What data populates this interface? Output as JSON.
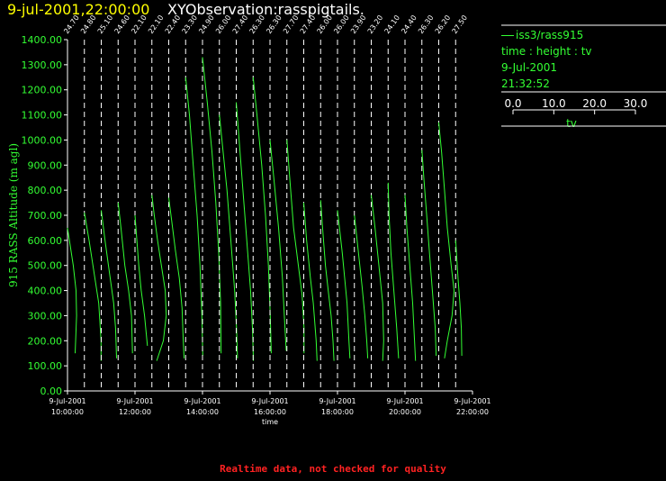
{
  "header": {
    "date_time": "9-jul-2001,22:00:00",
    "observation": "XYObservation:rasspigtails."
  },
  "legend": {
    "series_label": "iss3/rass915",
    "description": "time : height : tv",
    "date": "9-Jul-2001",
    "time": "21:32:52",
    "scale_ticks": [
      "0.0",
      "10.0",
      "20.0",
      "30.0"
    ],
    "scale_label": "tv"
  },
  "footer": {
    "note": "Realtime data, not checked for quality"
  },
  "colors": {
    "trace": "#33ff33",
    "axis": "#ffffff",
    "title_date": "#ffff00",
    "footer": "#ff2222",
    "background": "#000000"
  },
  "chart_data": {
    "type": "line",
    "title": "",
    "xlabel": "time",
    "ylabel": "915 RASS Altitude (m agl)",
    "ylim": [
      0,
      1400
    ],
    "xlim": [
      "2001-07-09 10:00",
      "2001-07-09 22:00"
    ],
    "y_ticks": [
      "0.00",
      "100.00",
      "200.00",
      "300.00",
      "400.00",
      "500.00",
      "600.00",
      "700.00",
      "800.00",
      "900.00",
      "1000.00",
      "1100.00",
      "1200.00",
      "1300.00",
      "1400.00"
    ],
    "x_ticks": [
      {
        "time": "2001-07-09 10:00",
        "date_label": "9-Jul-2001",
        "time_label": "10:00:00"
      },
      {
        "time": "2001-07-09 12:00",
        "date_label": "9-Jul-2001",
        "time_label": "12:00:00"
      },
      {
        "time": "2001-07-09 14:00",
        "date_label": "9-Jul-2001",
        "time_label": "14:00:00"
      },
      {
        "time": "2001-07-09 16:00",
        "date_label": "9-Jul-2001",
        "time_label": "16:00:00"
      },
      {
        "time": "2001-07-09 18:00",
        "date_label": "9-Jul-2001",
        "time_label": "18:00:00"
      },
      {
        "time": "2001-07-09 20:00",
        "date_label": "9-Jul-2001",
        "time_label": "20:00:00"
      },
      {
        "time": "2001-07-09 22:00",
        "date_label": "9-Jul-2001",
        "time_label": "22:00:00"
      }
    ],
    "grid": false,
    "profiles": [
      {
        "time": "2001-07-09 10:00",
        "base_label": "24.70",
        "points": [
          [
            650,
            0
          ],
          [
            500,
            1.2
          ],
          [
            400,
            1.8
          ],
          [
            300,
            1.9
          ],
          [
            150,
            1.6
          ]
        ]
      },
      {
        "time": "2001-07-09 10:30",
        "base_label": "24.80",
        "points": [
          [
            710,
            0
          ],
          [
            600,
            1.0
          ],
          [
            450,
            2.2
          ],
          [
            350,
            3.0
          ],
          [
            200,
            3.5
          ],
          [
            120,
            3.5
          ]
        ]
      },
      {
        "time": "2001-07-09 11:00",
        "base_label": "25.10",
        "points": [
          [
            720,
            0
          ],
          [
            600,
            0.8
          ],
          [
            500,
            1.5
          ],
          [
            350,
            2.6
          ],
          [
            250,
            3.0
          ],
          [
            130,
            3.2
          ]
        ]
      },
      {
        "time": "2001-07-09 11:30",
        "base_label": "24.60",
        "points": [
          [
            750,
            0
          ],
          [
            650,
            0.6
          ],
          [
            500,
            1.4
          ],
          [
            400,
            2.2
          ],
          [
            300,
            2.8
          ],
          [
            150,
            3.0
          ]
        ]
      },
      {
        "time": "2001-07-09 12:00",
        "base_label": "22.10",
        "points": [
          [
            700,
            0
          ],
          [
            600,
            0.4
          ],
          [
            500,
            0.8
          ],
          [
            400,
            1.3
          ],
          [
            300,
            2.0
          ],
          [
            180,
            2.6
          ]
        ]
      },
      {
        "time": "2001-07-09 12:30",
        "base_label": "22.10",
        "points": [
          [
            780,
            0
          ],
          [
            700,
            0.5
          ],
          [
            600,
            1.2
          ],
          [
            500,
            2.0
          ],
          [
            400,
            2.8
          ],
          [
            300,
            3.0
          ],
          [
            200,
            2.4
          ],
          [
            120,
            1.0
          ]
        ]
      },
      {
        "time": "2001-07-09 13:00",
        "base_label": "22.40",
        "points": [
          [
            770,
            0
          ],
          [
            680,
            0.6
          ],
          [
            560,
            1.4
          ],
          [
            450,
            2.2
          ],
          [
            330,
            2.8
          ],
          [
            220,
            3.0
          ],
          [
            130,
            3.2
          ]
        ]
      },
      {
        "time": "2001-07-09 13:30",
        "base_label": "23.30",
        "points": [
          [
            1250,
            0
          ],
          [
            1100,
            0.8
          ],
          [
            900,
            1.6
          ],
          [
            700,
            2.4
          ],
          [
            500,
            3.0
          ],
          [
            300,
            3.4
          ],
          [
            140,
            3.6
          ]
        ]
      },
      {
        "time": "2001-07-09 14:00",
        "base_label": "24.90",
        "points": [
          [
            1330,
            0
          ],
          [
            1150,
            1.0
          ],
          [
            950,
            2.0
          ],
          [
            750,
            2.8
          ],
          [
            550,
            3.4
          ],
          [
            350,
            3.8
          ],
          [
            150,
            3.9
          ]
        ]
      },
      {
        "time": "2001-07-09 14:30",
        "base_label": "26.00",
        "points": [
          [
            1100,
            0
          ],
          [
            950,
            0.8
          ],
          [
            800,
            1.6
          ],
          [
            600,
            2.4
          ],
          [
            400,
            3.2
          ],
          [
            250,
            3.6
          ],
          [
            130,
            3.8
          ]
        ]
      },
      {
        "time": "2001-07-09 15:00",
        "base_label": "27.40",
        "points": [
          [
            1150,
            0
          ],
          [
            1000,
            0.6
          ],
          [
            800,
            1.4
          ],
          [
            600,
            2.2
          ],
          [
            400,
            3.0
          ],
          [
            250,
            3.4
          ],
          [
            120,
            3.6
          ]
        ]
      },
      {
        "time": "2001-07-09 15:30",
        "base_label": "26.30",
        "points": [
          [
            1250,
            0
          ],
          [
            1100,
            0.8
          ],
          [
            900,
            1.8
          ],
          [
            700,
            2.6
          ],
          [
            500,
            3.2
          ],
          [
            300,
            3.6
          ],
          [
            150,
            3.8
          ]
        ]
      },
      {
        "time": "2001-07-09 16:00",
        "base_label": "26.30",
        "points": [
          [
            1000,
            0
          ],
          [
            850,
            0.8
          ],
          [
            650,
            1.8
          ],
          [
            450,
            2.6
          ],
          [
            300,
            3.0
          ],
          [
            160,
            3.4
          ]
        ]
      },
      {
        "time": "2001-07-09 16:30",
        "base_label": "27.70",
        "points": [
          [
            1000,
            0
          ],
          [
            850,
            0.6
          ],
          [
            650,
            1.4
          ],
          [
            500,
            2.4
          ],
          [
            380,
            3.2
          ],
          [
            250,
            3.6
          ],
          [
            150,
            3.6
          ]
        ]
      },
      {
        "time": "2001-07-09 17:00",
        "base_label": "27.40",
        "points": [
          [
            750,
            0
          ],
          [
            600,
            0.6
          ],
          [
            450,
            1.4
          ],
          [
            350,
            2.0
          ],
          [
            200,
            2.6
          ],
          [
            120,
            2.8
          ]
        ]
      },
      {
        "time": "2001-07-09 17:30",
        "base_label": "26.00",
        "points": [
          [
            760,
            0
          ],
          [
            650,
            0.4
          ],
          [
            500,
            1.0
          ],
          [
            400,
            1.6
          ],
          [
            300,
            2.2
          ],
          [
            200,
            2.6
          ],
          [
            120,
            2.8
          ]
        ]
      },
      {
        "time": "2001-07-09 18:00",
        "base_label": "26.00",
        "points": [
          [
            720,
            0
          ],
          [
            550,
            1.0
          ],
          [
            350,
            2.0
          ],
          [
            200,
            2.4
          ],
          [
            130,
            2.6
          ]
        ]
      },
      {
        "time": "2001-07-09 18:30",
        "base_label": "23.90",
        "points": [
          [
            700,
            0
          ],
          [
            560,
            0.8
          ],
          [
            420,
            1.6
          ],
          [
            300,
            2.2
          ],
          [
            200,
            2.6
          ],
          [
            130,
            2.8
          ]
        ]
      },
      {
        "time": "2001-07-09 19:00",
        "base_label": "23.20",
        "points": [
          [
            780,
            0
          ],
          [
            650,
            0.8
          ],
          [
            500,
            1.6
          ],
          [
            350,
            2.4
          ],
          [
            200,
            2.6
          ],
          [
            120,
            2.4
          ]
        ]
      },
      {
        "time": "2001-07-09 19:30",
        "base_label": "24.10",
        "points": [
          [
            830,
            0
          ],
          [
            700,
            0.2
          ],
          [
            550,
            0.6
          ],
          [
            400,
            1.2
          ],
          [
            250,
            1.8
          ],
          [
            130,
            2.2
          ]
        ]
      },
      {
        "time": "2001-07-09 20:00",
        "base_label": "24.40",
        "points": [
          [
            780,
            0
          ],
          [
            650,
            0.4
          ],
          [
            500,
            1.0
          ],
          [
            350,
            1.6
          ],
          [
            200,
            2.0
          ],
          [
            120,
            2.2
          ]
        ]
      },
      {
        "time": "2001-07-09 20:30",
        "base_label": "26.30",
        "points": [
          [
            960,
            0
          ],
          [
            850,
            0.4
          ],
          [
            700,
            1.0
          ],
          [
            550,
            1.6
          ],
          [
            400,
            2.2
          ],
          [
            250,
            2.8
          ],
          [
            140,
            3.0
          ]
        ]
      },
      {
        "time": "2001-07-09 21:00",
        "base_label": "26.20",
        "points": [
          [
            1070,
            0
          ],
          [
            950,
            0.6
          ],
          [
            800,
            1.2
          ],
          [
            650,
            1.8
          ],
          [
            500,
            2.6
          ],
          [
            400,
            3.2
          ],
          [
            300,
            2.8
          ],
          [
            200,
            1.8
          ],
          [
            130,
            1.2
          ]
        ]
      },
      {
        "time": "2001-07-09 21:30",
        "base_label": "27.50",
        "points": [
          [
            600,
            0
          ],
          [
            450,
            0.5
          ],
          [
            350,
            0.9
          ],
          [
            250,
            1.2
          ],
          [
            140,
            1.3
          ]
        ]
      }
    ]
  }
}
